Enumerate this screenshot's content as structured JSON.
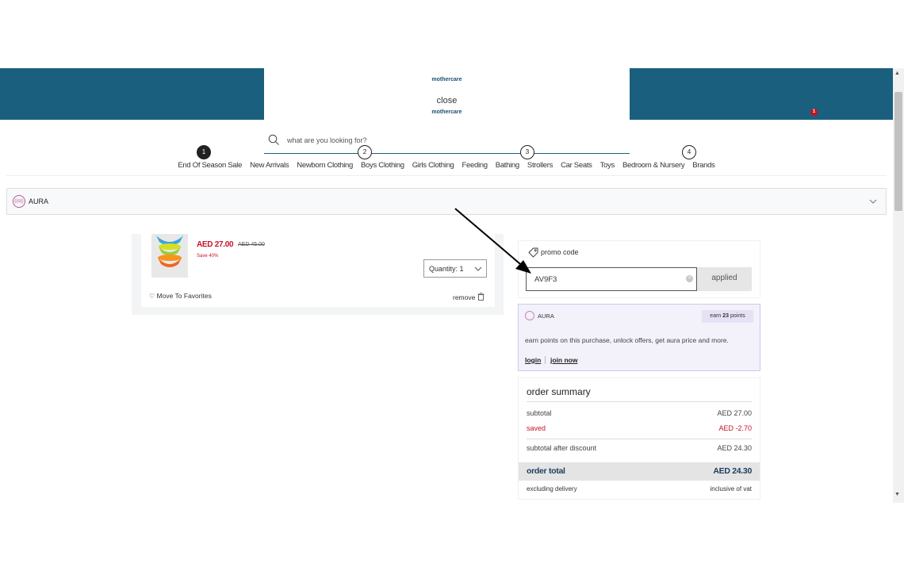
{
  "header": {
    "brand_top": "mothercare",
    "close_label": "close",
    "brand_bottom": "mothercare",
    "cart_badge": "1",
    "brand_color": "#1b5f7f"
  },
  "search": {
    "placeholder": "what are you looking for?",
    "icon": "search-icon"
  },
  "steps": [
    "1",
    "2",
    "3",
    "4"
  ],
  "nav": {
    "items": [
      "End Of Season Sale",
      "New Arrivals",
      "Newborn Clothing",
      "Boys Clothing",
      "Girls Clothing",
      "Feeding",
      "Bathing",
      "Strollers",
      "Car Seats",
      "Toys",
      "Bedroom & Nursery",
      "Brands"
    ]
  },
  "aura_bar": {
    "logo_text": "((ɑ))",
    "label": "AURA",
    "icon": "chevron-down-icon"
  },
  "cart": {
    "item": {
      "price": "AED 27.00",
      "original_price": "AED 45.00",
      "discount": "Save 40%",
      "quantity_label": "Quantity: 1",
      "favorite_label": "Move To Favorites",
      "remove_label": "remove"
    }
  },
  "promo": {
    "label": "promo code",
    "value": "AV9F3",
    "clear_icon": "×",
    "applied_label": "applied"
  },
  "aura_panel": {
    "label": "AURA",
    "earn_prefix": "earn",
    "earn_points": "23",
    "earn_suffix": "points",
    "description": "earn points on this purchase, unlock offers, get aura price and more.",
    "login_label": "login",
    "join_label": "join now"
  },
  "summary": {
    "title": "order summary",
    "subtotal_label": "subtotal",
    "subtotal_value": "AED 27.00",
    "saved_label": "saved",
    "saved_value": "AED -2.70",
    "after_discount_label": "subtotal after discount",
    "after_discount_value": "AED 24.30",
    "total_label": "order total",
    "total_value": "AED 24.30",
    "delivery_note": "excluding delivery",
    "vat_note": "inclusive of vat"
  },
  "colors": {
    "accent": "#1b5f7f",
    "sale_red": "#c5132a",
    "aura_panel_bg": "#f3f1fa"
  }
}
